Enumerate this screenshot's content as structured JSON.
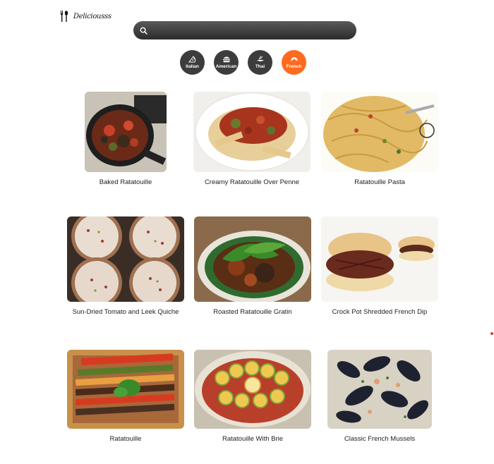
{
  "brand": {
    "name": "Deliciousss",
    "icon": "fork-spoon-icon"
  },
  "search": {
    "placeholder": "",
    "value": "",
    "icon": "search-icon"
  },
  "categories": [
    {
      "label": "Italian",
      "icon": "pizza-icon",
      "active": false
    },
    {
      "label": "American",
      "icon": "burger-icon",
      "active": false
    },
    {
      "label": "Thai",
      "icon": "thai-dish-icon",
      "active": false
    },
    {
      "label": "French",
      "icon": "croissant-icon",
      "active": true
    }
  ],
  "colors": {
    "accent": "#ff6a1f",
    "chip": "#3c3c3c",
    "search_bar": "#3a3a3a"
  },
  "recipes": [
    {
      "title": "Baked Ratatouille"
    },
    {
      "title": "Creamy Ratatouille Over Penne"
    },
    {
      "title": "Ratatouille Pasta"
    },
    {
      "title": "Sun-Dried Tomato and Leek Quiche"
    },
    {
      "title": "Roasted Ratatouille Gratin"
    },
    {
      "title": "Crock Pot Shredded French Dip"
    },
    {
      "title": "Ratatouille"
    },
    {
      "title": "Ratatouille With Brie"
    },
    {
      "title": "Classic French Mussels"
    }
  ]
}
